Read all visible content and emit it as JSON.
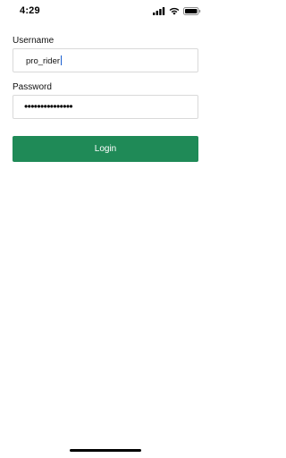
{
  "status_bar": {
    "time": "4:29",
    "icons": [
      "signal-icon",
      "wifi-icon",
      "battery-icon"
    ]
  },
  "form": {
    "username_label": "Username",
    "username_value": "pro_rider",
    "password_label": "Password",
    "password_masked": "•••••••••••••••",
    "login_label": "Login"
  },
  "colors": {
    "primary_button": "#1f8a57",
    "caret": "#1a5fd0",
    "input_border": "#d9d9d9"
  }
}
